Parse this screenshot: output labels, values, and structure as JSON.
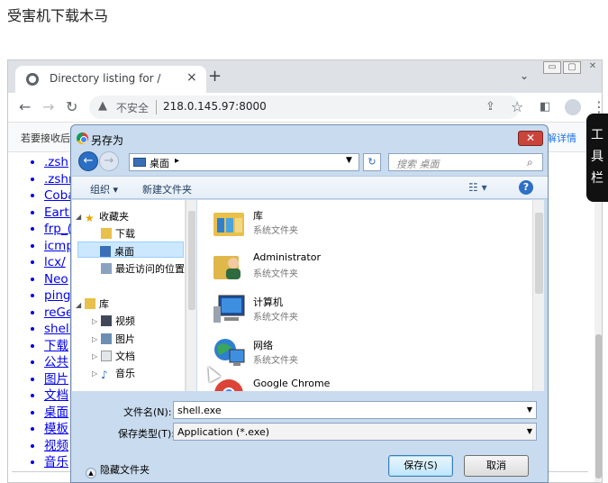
{
  "caption": "受害机下载木马",
  "browser": {
    "tab_title": "Directory listing for /",
    "tab_close": "×",
    "new_tab": "+",
    "tab_dropdown": "⌄",
    "window_controls": [
      "▭",
      "▢",
      "✕"
    ],
    "insecure_label": "不安全",
    "url": "218.0.145.97:8000",
    "infobar_text": "若要接收后",
    "infobar_link": "解详情",
    "listing": [
      ".zsh",
      ".zshr",
      "Coba",
      "Earth",
      "frp_(",
      "icmp",
      "lcx/",
      "Neo",
      "ping",
      "reGe",
      "shell",
      "下载",
      "公共",
      "图片",
      "文档",
      "桌面",
      "模板",
      "视频",
      "音乐"
    ],
    "listing_partial_top": "..."
  },
  "side_panel": {
    "chars": [
      "工",
      "具",
      "栏"
    ]
  },
  "dialog": {
    "title": "另存为",
    "close": "✕",
    "location": "桌面",
    "search_placeholder": "搜索 桌面",
    "commands": {
      "organize": "组织 ▾",
      "new_folder": "新建文件夹"
    },
    "nav": {
      "favorites": "收藏夹",
      "downloads": "下载",
      "desktop": "桌面",
      "recent": "最近访问的位置",
      "libraries": "库",
      "videos": "视频",
      "pictures": "图片",
      "documents": "文档",
      "music": "音乐"
    },
    "files": [
      {
        "name": "库",
        "type": "系统文件夹",
        "icon": "library-folder-icon"
      },
      {
        "name": "Administrator",
        "type": "系统文件夹",
        "icon": "user-folder-icon"
      },
      {
        "name": "计算机",
        "type": "系统文件夹",
        "icon": "computer-icon"
      },
      {
        "name": "网络",
        "type": "系统文件夹",
        "icon": "network-icon"
      },
      {
        "name": "Google Chrome",
        "type": "",
        "icon": "chrome-icon"
      }
    ],
    "filename_label": "文件名(N):",
    "filename_value": "shell.exe",
    "filetype_label": "保存类型(T):",
    "filetype_value": "Application (*.exe)",
    "hide_folders": "隐藏文件夹",
    "save_button": "保存(S)",
    "cancel_button": "取消"
  }
}
